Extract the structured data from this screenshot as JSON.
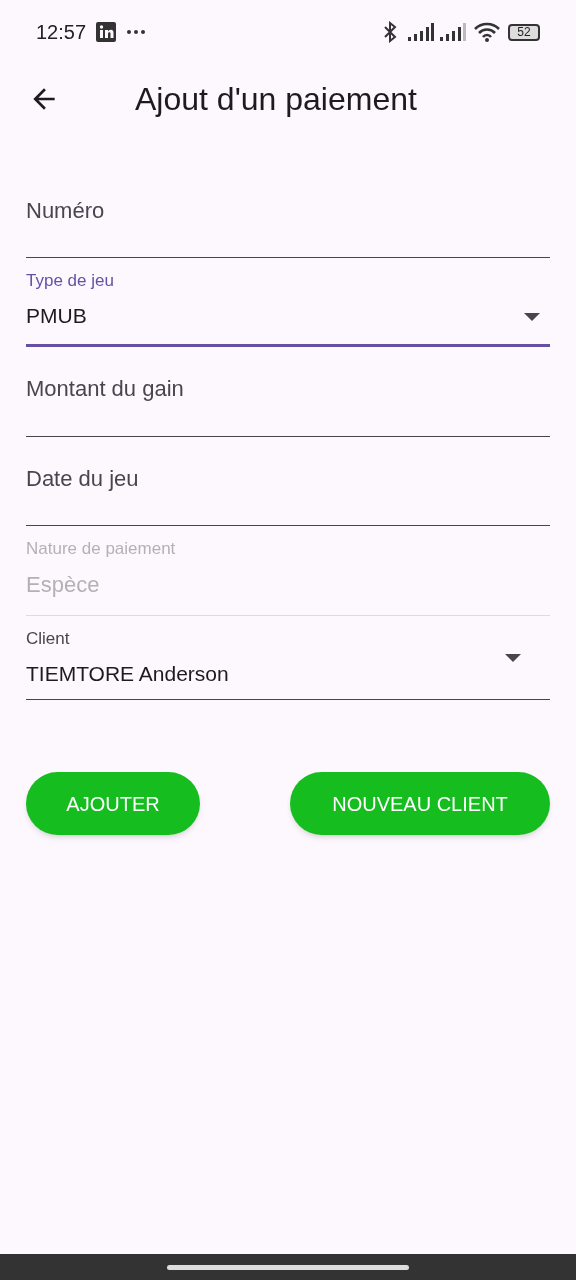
{
  "status_bar": {
    "time": "12:57",
    "battery": "52"
  },
  "header": {
    "title": "Ajout d'un paiement"
  },
  "fields": [
    {
      "kind": "text",
      "placeholder": "Numéro",
      "focused": false,
      "disabled": false
    },
    {
      "kind": "dropdown",
      "label": "Type de jeu",
      "value": "PMUB",
      "focused": true,
      "disabled": false
    },
    {
      "kind": "text",
      "placeholder": "Montant du gain",
      "focused": false,
      "disabled": false
    },
    {
      "kind": "text",
      "placeholder": "Date du jeu",
      "focused": false,
      "disabled": false
    },
    {
      "kind": "text",
      "label": "Nature de paiement",
      "value": "Espèce",
      "focused": false,
      "disabled": true
    },
    {
      "kind": "dropdown",
      "label": "Client",
      "value": "TIEMTORE Anderson",
      "focused": false,
      "disabled": false
    }
  ],
  "buttons": [
    "AJOUTER",
    "NOUVEAU CLIENT"
  ]
}
